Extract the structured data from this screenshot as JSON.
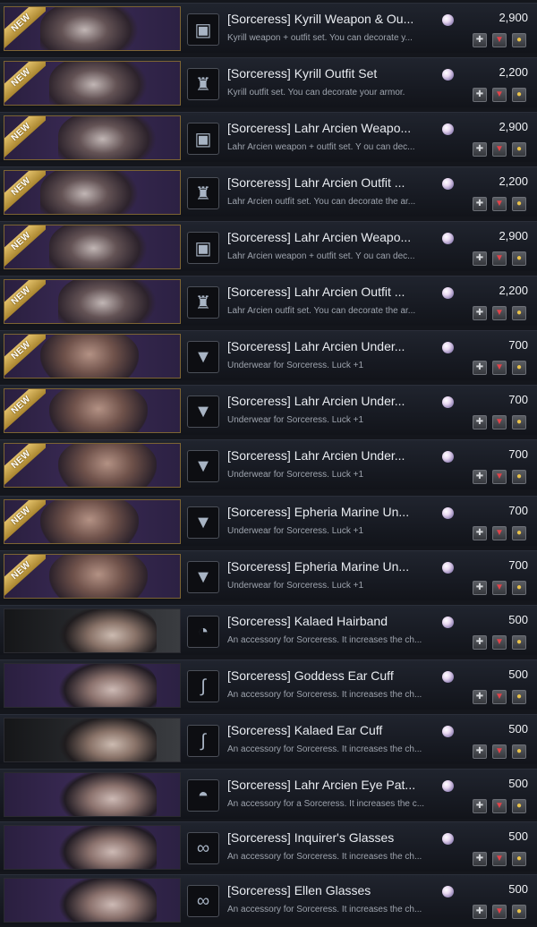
{
  "new_badge": "NEW",
  "items": [
    {
      "name": "[Sorceress] Kyrill Weapon & Ou...",
      "desc": "Kyrill weapon + outfit set. You can decorate y...",
      "price": "2,900",
      "icon": "chest-icon",
      "new": true
    },
    {
      "name": "[Sorceress] Kyrill Outfit Set",
      "desc": "Kyrill outfit set. You can decorate your armor.",
      "price": "2,200",
      "icon": "outfit-icon",
      "new": true
    },
    {
      "name": "[Sorceress] Lahr Arcien Weapo...",
      "desc": "Lahr Arcien weapon + outfit set. Y ou can dec...",
      "price": "2,900",
      "icon": "chest-icon",
      "new": true
    },
    {
      "name": "[Sorceress] Lahr Arcien Outfit ...",
      "desc": "Lahr Arcien outfit set. You can decorate the ar...",
      "price": "2,200",
      "icon": "outfit-icon",
      "new": true
    },
    {
      "name": "[Sorceress] Lahr Arcien Weapo...",
      "desc": "Lahr Arcien weapon + outfit set. Y ou can dec...",
      "price": "2,900",
      "icon": "chest-icon",
      "new": true
    },
    {
      "name": "[Sorceress] Lahr Arcien Outfit ...",
      "desc": "Lahr Arcien outfit set. You can decorate the ar...",
      "price": "2,200",
      "icon": "outfit-icon",
      "new": true
    },
    {
      "name": "[Sorceress] Lahr Arcien Under...",
      "desc": "Underwear for Sorceress. Luck +1",
      "price": "700",
      "icon": "underwear-icon",
      "new": true
    },
    {
      "name": "[Sorceress] Lahr Arcien Under...",
      "desc": "Underwear for Sorceress. Luck +1",
      "price": "700",
      "icon": "underwear-icon",
      "new": true
    },
    {
      "name": "[Sorceress] Lahr Arcien Under...",
      "desc": "Underwear for Sorceress. Luck +1",
      "price": "700",
      "icon": "underwear-icon",
      "new": true
    },
    {
      "name": "[Sorceress] Epheria Marine Un...",
      "desc": "Underwear for Sorceress. Luck +1",
      "price": "700",
      "icon": "underwear-icon",
      "new": true
    },
    {
      "name": "[Sorceress] Epheria Marine Un...",
      "desc": "Underwear for Sorceress. Luck +1",
      "price": "700",
      "icon": "underwear-icon",
      "new": true
    },
    {
      "name": "[Sorceress] Kalaed Hairband",
      "desc": "An accessory for Sorceress. It increases the ch...",
      "price": "500",
      "icon": "hairband-icon",
      "new": false
    },
    {
      "name": "[Sorceress] Goddess Ear Cuff",
      "desc": "An accessory for Sorceress. It increases the ch...",
      "price": "500",
      "icon": "earcuff-icon",
      "new": false
    },
    {
      "name": "[Sorceress] Kalaed Ear Cuff",
      "desc": "An accessory for Sorceress. It increases the ch...",
      "price": "500",
      "icon": "earcuff-icon",
      "new": false
    },
    {
      "name": "[Sorceress] Lahr Arcien Eye Pat...",
      "desc": "An accessory for a Sorceress. It increases the c...",
      "price": "500",
      "icon": "eyepatch-icon",
      "new": false
    },
    {
      "name": "[Sorceress] Inquirer's Glasses",
      "desc": "An accessory for Sorceress. It increases the ch...",
      "price": "500",
      "icon": "glasses-icon",
      "new": false
    },
    {
      "name": "[Sorceress] Ellen Glasses",
      "desc": "An accessory for Sorceress. It increases the ch...",
      "price": "500",
      "icon": "glasses-icon",
      "new": false
    }
  ]
}
